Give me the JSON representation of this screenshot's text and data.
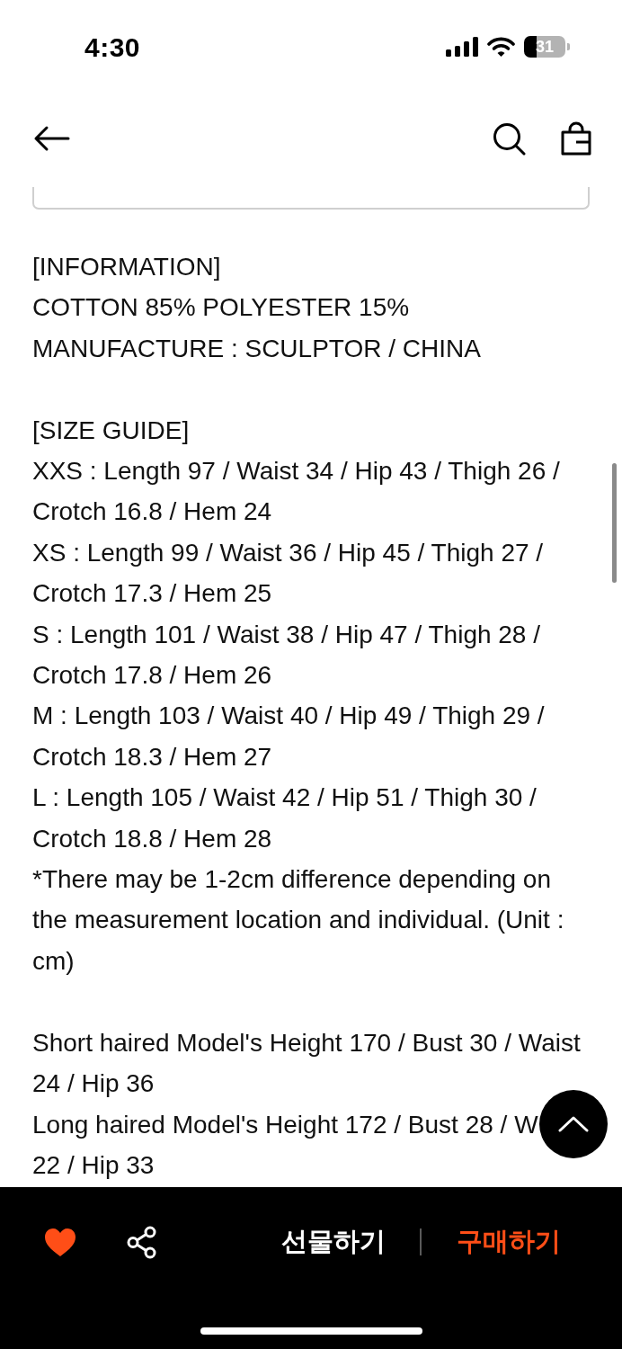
{
  "status_bar": {
    "time": "4:30",
    "battery": "31"
  },
  "description": {
    "sections": [
      {
        "paragraphs": [
          "[INFORMATION]",
          "COTTON 85% POLYESTER 15%",
          "MANUFACTURE : SCULPTOR / CHINA"
        ]
      },
      {
        "paragraphs": [
          "[SIZE GUIDE]",
          "XXS : Length 97 / Waist 34 / Hip 43 / Thigh 26 / Crotch 16.8 / Hem 24",
          "XS : Length 99 / Waist 36 / Hip 45 / Thigh 27 / Crotch 17.3 / Hem 25",
          "S : Length 101 / Waist 38 / Hip 47 / Thigh 28 / Crotch 17.8 / Hem 26",
          "M : Length 103 / Waist 40 / Hip 49 / Thigh 29 / Crotch 18.3 / Hem 27",
          "L : Length 105 / Waist 42 / Hip 51 / Thigh 30 / Crotch 18.8 / Hem 28",
          "*There may be 1-2cm difference depending on the measurement location and individual. (Unit : cm)"
        ]
      },
      {
        "paragraphs": [
          "Short haired Model's Height 170 / Bust 30 / Waist 24 / Hip 36",
          "Long haired Model's Height 172 / Bust 28 / W\n22 / Hip 33"
        ]
      }
    ]
  },
  "bottom_bar": {
    "liked": true,
    "gift_label": "선물하기",
    "buy_label": "구매하기"
  }
}
